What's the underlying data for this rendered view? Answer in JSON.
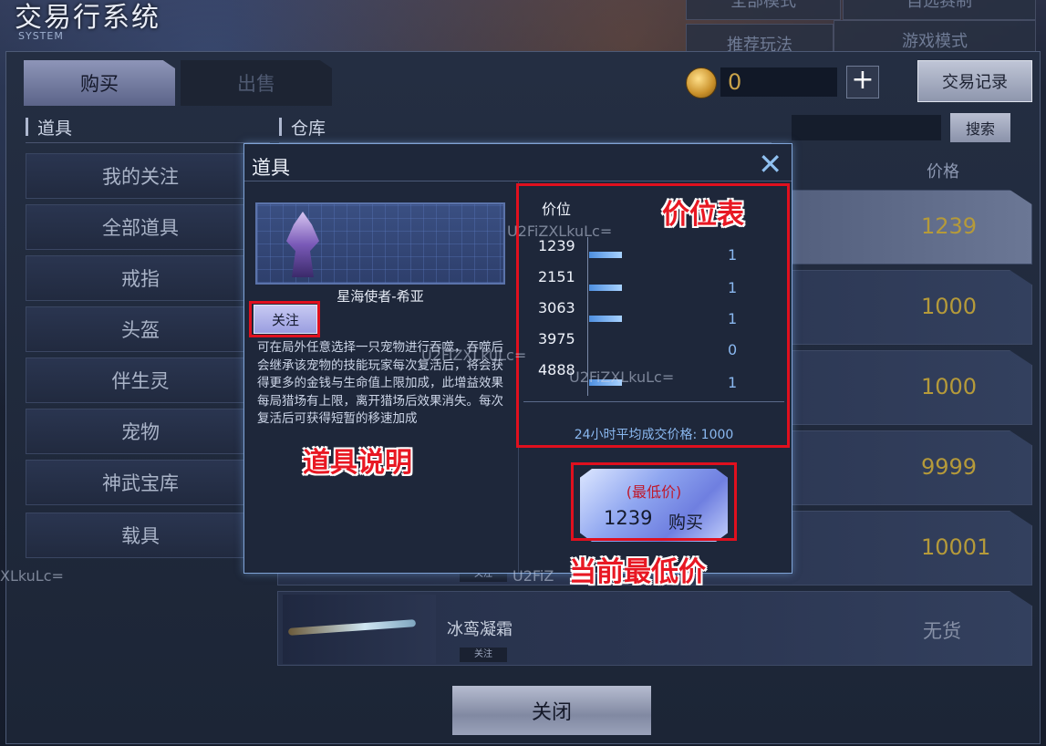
{
  "system": {
    "title": "交易行系统",
    "subtitle": "SYSTEM"
  },
  "ghost_tabs": [
    "全部模式",
    "自选赛制",
    "推荐玩法",
    "游戏模式"
  ],
  "tabs": {
    "buy": "购买",
    "sell": "出售"
  },
  "currency": {
    "amount": "0",
    "icon": "gold-coin-icon",
    "add_symbol": "+"
  },
  "trade_record_label": "交易记录",
  "left_panel": {
    "header": "道具",
    "categories": [
      "我的关注",
      "全部道具",
      "戒指",
      "头盔",
      "伴生灵",
      "宠物",
      "神武宝库",
      "载具"
    ]
  },
  "right_panel": {
    "header": "仓库",
    "search_label": "搜索",
    "price_header": "价格",
    "rows": [
      {
        "price": "1239"
      },
      {
        "price": "1000"
      },
      {
        "price": "1000"
      },
      {
        "price": "9999"
      },
      {
        "price": "10001",
        "follow": "关注"
      },
      {
        "name": "冰鸾凝霜",
        "follow": "关注",
        "price": "无货"
      }
    ]
  },
  "close_label": "关闭",
  "modal": {
    "title": "道具",
    "close_symbol": "✕",
    "item_name": "星海使者-希亚",
    "follow_label": "关注",
    "description": "可在局外任意选择一只宠物进行吞噬，吞噬后会继承该宠物的技能玩家每次复活后，将会获得更多的金钱与生命值上限加成，此增益效果每局猎场有上限，离开猎场后效果消失。每次复活后可获得短暂的移速加成",
    "price_table": {
      "header": "价位",
      "levels": [
        {
          "price": "1239",
          "count": 1
        },
        {
          "price": "2151",
          "count": 1
        },
        {
          "price": "3063",
          "count": 1
        },
        {
          "price": "3975",
          "count": 0
        },
        {
          "price": "4888",
          "count": 1
        }
      ],
      "avg_text": "24小时平均成交价格: 1000"
    },
    "buy_button": {
      "label": "(最低价)",
      "price": "1239",
      "action": "购买"
    }
  },
  "annotations": {
    "price_table": "价位表",
    "item_desc": "道具说明",
    "lowest_price": "当前最低价"
  },
  "watermarks": [
    "U2FiZXLkuLc=",
    "U2FiZXLkuLc=",
    "U2FiZXLkuLc=",
    "XLkuLc=",
    "U2FiZ"
  ],
  "colors": {
    "annotation": "#e0101e",
    "price_gold": "#b59a3a",
    "accent_blue": "#8ab8f0"
  }
}
